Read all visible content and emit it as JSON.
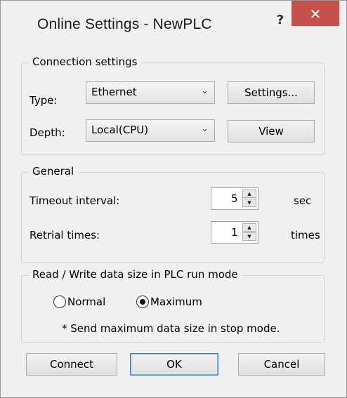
{
  "window": {
    "title": "Online Settings - NewPLC",
    "help_glyph": "?",
    "close_glyph": "✕"
  },
  "connection": {
    "legend": "Connection settings",
    "type_label": "Type:",
    "type_value": "Ethernet",
    "settings_button": "Settings...",
    "depth_label": "Depth:",
    "depth_value": "Local(CPU)",
    "view_button": "View"
  },
  "general": {
    "legend": "General",
    "timeout_label": "Timeout interval:",
    "timeout_value": "5",
    "timeout_unit": "sec",
    "retrial_label": "Retrial times:",
    "retrial_value": "1",
    "retrial_unit": "times"
  },
  "readwrite": {
    "legend": "Read / Write data size in PLC run mode",
    "option_normal": "Normal",
    "option_maximum": "Maximum",
    "selected": "Maximum",
    "note": "* Send maximum data size in stop mode."
  },
  "buttons": {
    "connect": "Connect",
    "ok": "OK",
    "cancel": "Cancel"
  },
  "icons": {
    "combo_arrow": "chevron-down-icon",
    "spin_up": "triangle-up-icon",
    "spin_down": "triangle-down-icon"
  }
}
